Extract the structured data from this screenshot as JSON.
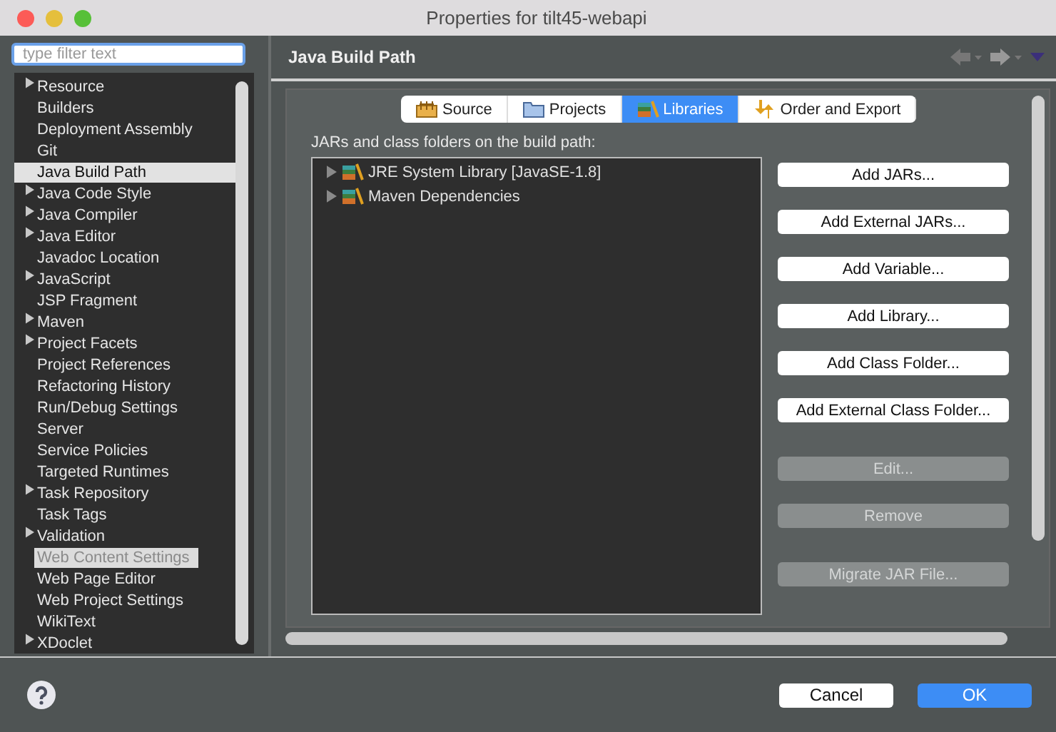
{
  "window": {
    "title": "Properties for tilt45-webapi"
  },
  "filter": {
    "placeholder": "type filter text"
  },
  "sidebar": {
    "items": [
      {
        "label": "Resource",
        "expandable": true,
        "selected": false,
        "kind": "normal"
      },
      {
        "label": "Builders",
        "expandable": false,
        "selected": false,
        "kind": "normal"
      },
      {
        "label": "Deployment Assembly",
        "expandable": false,
        "selected": false,
        "kind": "normal"
      },
      {
        "label": "Git",
        "expandable": false,
        "selected": false,
        "kind": "normal"
      },
      {
        "label": "Java Build Path",
        "expandable": false,
        "selected": true,
        "kind": "normal"
      },
      {
        "label": "Java Code Style",
        "expandable": true,
        "selected": false,
        "kind": "normal"
      },
      {
        "label": "Java Compiler",
        "expandable": true,
        "selected": false,
        "kind": "normal"
      },
      {
        "label": "Java Editor",
        "expandable": true,
        "selected": false,
        "kind": "normal"
      },
      {
        "label": "Javadoc Location",
        "expandable": false,
        "selected": false,
        "kind": "normal"
      },
      {
        "label": "JavaScript",
        "expandable": true,
        "selected": false,
        "kind": "normal"
      },
      {
        "label": "JSP Fragment",
        "expandable": false,
        "selected": false,
        "kind": "normal"
      },
      {
        "label": "Maven",
        "expandable": true,
        "selected": false,
        "kind": "normal"
      },
      {
        "label": "Project Facets",
        "expandable": true,
        "selected": false,
        "kind": "normal"
      },
      {
        "label": "Project References",
        "expandable": false,
        "selected": false,
        "kind": "normal"
      },
      {
        "label": "Refactoring History",
        "expandable": false,
        "selected": false,
        "kind": "normal"
      },
      {
        "label": "Run/Debug Settings",
        "expandable": false,
        "selected": false,
        "kind": "normal"
      },
      {
        "label": "Server",
        "expandable": false,
        "selected": false,
        "kind": "normal"
      },
      {
        "label": "Service Policies",
        "expandable": false,
        "selected": false,
        "kind": "normal"
      },
      {
        "label": "Targeted Runtimes",
        "expandable": false,
        "selected": false,
        "kind": "normal"
      },
      {
        "label": "Task Repository",
        "expandable": true,
        "selected": false,
        "kind": "normal"
      },
      {
        "label": "Task Tags",
        "expandable": false,
        "selected": false,
        "kind": "normal"
      },
      {
        "label": "Validation",
        "expandable": true,
        "selected": false,
        "kind": "normal"
      },
      {
        "label": "Web Content Settings",
        "expandable": false,
        "selected": false,
        "kind": "drag"
      },
      {
        "label": "Web Page Editor",
        "expandable": false,
        "selected": false,
        "kind": "normal"
      },
      {
        "label": "Web Project Settings",
        "expandable": false,
        "selected": false,
        "kind": "normal"
      },
      {
        "label": "WikiText",
        "expandable": false,
        "selected": false,
        "kind": "normal"
      },
      {
        "label": "XDoclet",
        "expandable": true,
        "selected": false,
        "kind": "normal"
      }
    ]
  },
  "page": {
    "title": "Java Build Path"
  },
  "tabs": [
    {
      "label": "Source",
      "kind": "source",
      "selected": false
    },
    {
      "label": "Projects",
      "kind": "projects",
      "selected": false
    },
    {
      "label": "Libraries",
      "kind": "libraries",
      "selected": true
    },
    {
      "label": "Order and Export",
      "kind": "order",
      "selected": false
    }
  ],
  "libraries": {
    "caption": "JARs and class folders on the build path:",
    "entries": [
      {
        "label": "JRE System Library [JavaSE-1.8]",
        "expanded": false
      },
      {
        "label": "Maven Dependencies",
        "expanded": false
      }
    ],
    "buttons": [
      {
        "label": "Add JARs...",
        "disabled": false,
        "gap": false
      },
      {
        "label": "Add External JARs...",
        "disabled": false,
        "gap": false
      },
      {
        "label": "Add Variable...",
        "disabled": false,
        "gap": false
      },
      {
        "label": "Add Library...",
        "disabled": false,
        "gap": false
      },
      {
        "label": "Add Class Folder...",
        "disabled": false,
        "gap": false
      },
      {
        "label": "Add External Class Folder...",
        "disabled": false,
        "gap": false
      },
      {
        "label": "Edit...",
        "disabled": true,
        "gap": true
      },
      {
        "label": "Remove",
        "disabled": true,
        "gap": false
      },
      {
        "label": "Migrate JAR File...",
        "disabled": true,
        "gap": true
      }
    ]
  },
  "footer": {
    "cancel": "Cancel",
    "ok": "OK"
  }
}
